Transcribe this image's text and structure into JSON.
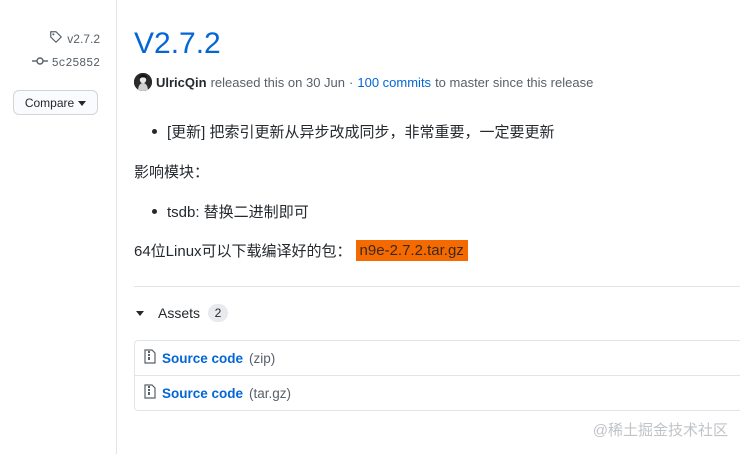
{
  "sidebar": {
    "tag": "v2.7.2",
    "commit": "5c25852",
    "compare_label": "Compare"
  },
  "release": {
    "title": "V2.7.2",
    "author": "UlricQin",
    "released_text": "released this on 30 Jun",
    "separator": "·",
    "commits_link": "100 commits",
    "commits_suffix": "to master since this release"
  },
  "notes": {
    "bullet1": "[更新] 把索引更新从异步改成同步，非常重要，一定要更新",
    "para1": "影响模块：",
    "bullet2": "tsdb: 替换二进制即可",
    "para2_prefix": "64位Linux可以下载编译好的包：",
    "para2_file": "n9e-2.7.2.tar.gz"
  },
  "assets": {
    "label": "Assets",
    "count": "2",
    "items": [
      {
        "name": "Source code",
        "ext": "(zip)"
      },
      {
        "name": "Source code",
        "ext": "(tar.gz)"
      }
    ]
  },
  "watermark": "@稀土掘金技术社区"
}
